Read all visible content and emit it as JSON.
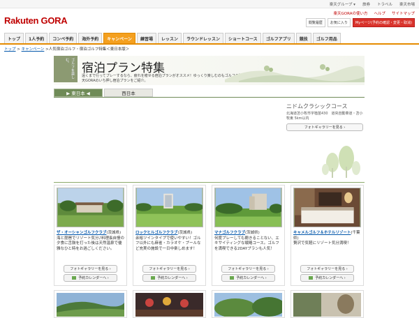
{
  "util_links": [
    "楽天グループ ▾",
    "旅券",
    "トラベル",
    "楽天市場"
  ],
  "logo": {
    "brand": "Rakuten",
    "product": "GORA"
  },
  "header_links": [
    "楽天GORAの使い方",
    "ヘルプ",
    "サイトマップ"
  ],
  "header_buttons": {
    "history": "閲覧履歴",
    "favorites": "お気に入り",
    "my_page": "Myページ(予約の確認・変更・取消)"
  },
  "nav": [
    "トップ",
    "1人予約",
    "コンペ予約",
    "海外予約",
    "キャンペーン",
    "練習場",
    "レッスン",
    "ラウンドレッスン",
    "ショートコース",
    "ゴルフアプリ",
    "競技",
    "ゴルフ用品"
  ],
  "breadcrumb": {
    "top": "トップ",
    "campaign": "キャンペーン",
    "current": ">人気宿泊ゴルフ・宿泊ゴルフ特集＜東日本版＞"
  },
  "hero": {
    "seal": "ゴルフを楽しむ。",
    "title": "宿泊プラン特集",
    "desc": "遠くまで行ってプレーするなら、疲れを癒せる宿泊プランがオススメ！ゆっくり楽しむのもゴルフの醍醐味。楽天GORAのいち押し宿泊プランをご紹介。"
  },
  "tabs": {
    "east": "▶ 東日本 ◀",
    "west": "西日本"
  },
  "featured": {
    "name": "ニドムクラシックコース",
    "address": "北海道苫小牧市字植苗430　道央自動車道・苫小牧東 5km以内",
    "photo_button": "フォトギャラリーを見る ›"
  },
  "cards": [
    {
      "name": "ザ・オーシャンゴルフクラブ",
      "pref": "(茨城県)",
      "desc": "海と琵琶でリゾート気分♪料理長自慢の夕食に舌鼓を打った後は天然温泉で優雅なひと時をお過ごしください。",
      "photo": "フォトギャラリーを見る ›",
      "calendar": "予約カレンダーへ ›"
    },
    {
      "name": "ロックヒルゴルフクラブ",
      "pref": "(茨城県)",
      "desc": "余裕ツインタイプで使いやすい！ゴルフ以外にも麻雀・カラオケ・プールなど充実の施設で一日中楽しめます！",
      "photo": "フォトギャラリーを見る ›",
      "calendar": "予約カレンダーへ ›"
    },
    {
      "name": "マナゴルフクラブ",
      "pref": "(茨城県)",
      "desc": "何度プレーしても飽きることない、エキサイティングな戦略コース。ゴルフを満喫できる2DAYプランも人気！",
      "photo": "フォトギャラリーを見る ›",
      "calendar": "予約カレンダーへ ›"
    },
    {
      "name": "キャメルゴルフ＆ホテルリゾート",
      "pref": "(千葉県)",
      "desc": "贅沢で気軽にリゾート気分満喫！",
      "photo": "フォトギャラリーを見る ›",
      "calendar": "予約カレンダーへ ›"
    }
  ],
  "colors": {
    "brand_red": "#bf0000",
    "nav_active": "#f4a020",
    "tab_green": "#6f8b57"
  }
}
